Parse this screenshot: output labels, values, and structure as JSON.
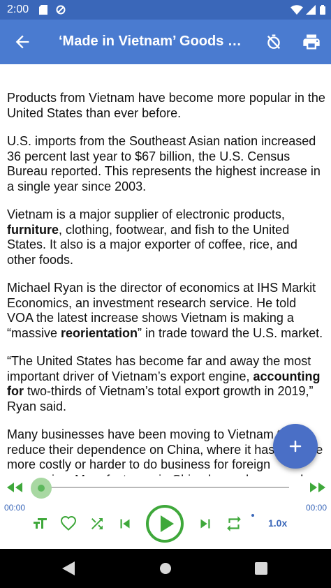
{
  "status_bar": {
    "time": "2:00"
  },
  "app_bar": {
    "title": "‘Made in Vietnam’ Goods Grow in US"
  },
  "article": {
    "paragraphs": [
      [
        {
          "t": "Products from Vietnam have become more popular in the United States than ever before."
        }
      ],
      [
        {
          "t": "U.S. imports from the Southeast Asian nation increased 36 percent last year to $67 billion, the U.S. Census Bureau reported. This represents the highest increase in a single year since 2003."
        }
      ],
      [
        {
          "t": "Vietnam is a major supplier of electronic products, "
        },
        {
          "t": "furniture",
          "b": true
        },
        {
          "t": ", clothing, footwear, and fish to the United States. It also is a major exporter of coffee, rice, and other foods."
        }
      ],
      [
        {
          "t": "Michael Ryan is the director of economics at IHS Markit Economics, an investment research service. He told VOA the latest increase shows Vietnam is making a “massive "
        },
        {
          "t": "reorientation",
          "b": true
        },
        {
          "t": "” in trade toward the U.S. market."
        }
      ],
      [
        {
          "t": "“The United States has become far and away the most important driver of Vietnam’s export engine, "
        },
        {
          "t": "accounting for",
          "b": true
        },
        {
          "t": " two-thirds of Vietnam’s total export growth in 2019,” Ryan said."
        }
      ],
      [
        {
          "t": "Many businesses have been moving to Vietnam to reduce their dependence on China, where it has become more costly or harder to do business for foreign companies. Manufacturers in China have also moved..."
        }
      ]
    ]
  },
  "player": {
    "elapsed": "00:00",
    "duration": "00:00",
    "progress": 0,
    "speed": "1.0x",
    "accent": "#3fa83b",
    "secondary_accent": "#3a67b9"
  },
  "icons": {
    "back": "arrow-back-icon",
    "timer_off": "timer-off-icon",
    "print": "print-icon",
    "fab": "add-icon",
    "rewind": "rewind-icon",
    "fast_forward": "fast-forward-icon",
    "text_size": "text-size-icon",
    "favorite": "heart-icon",
    "shuffle": "shuffle-icon",
    "skip_previous": "skip-previous-icon",
    "play": "play-icon",
    "skip_next": "skip-next-icon",
    "repeat": "repeat-icon"
  },
  "colors": {
    "app_bar": "#4a7bd0",
    "status_bar": "#3a67b9",
    "fab": "#4a6fc6",
    "nav_bar": "#000000"
  }
}
